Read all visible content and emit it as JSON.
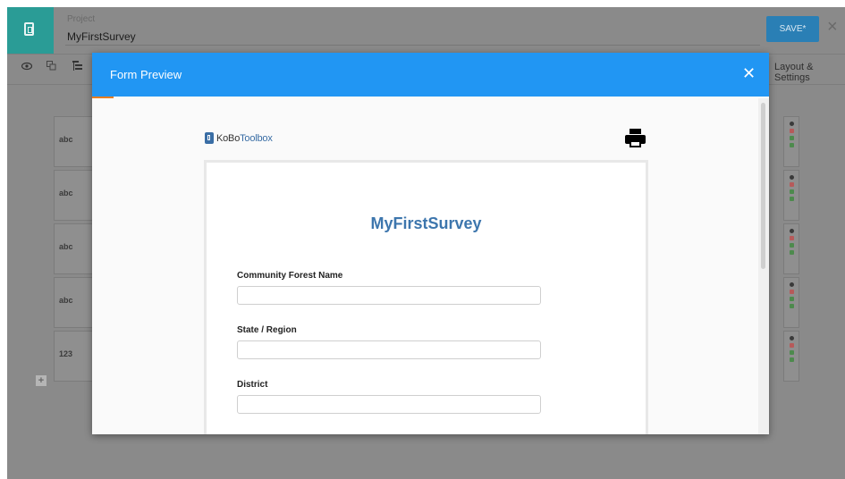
{
  "header": {
    "project_label": "Project",
    "project_name": "MyFirstSurvey",
    "save_label": "SAVE*",
    "close_glyph": "×"
  },
  "toolbar": {
    "preview_icon": "eye-icon",
    "layout_settings_label": "Layout & Settings"
  },
  "rows": [
    {
      "type": "abc"
    },
    {
      "type": "abc"
    },
    {
      "type": "abc"
    },
    {
      "type": "abc"
    },
    {
      "type": "123"
    }
  ],
  "modal": {
    "title": "Form Preview",
    "close_glyph": "✕",
    "logo_text_kobo": "KoBo",
    "logo_text_toolbox": "Toolbox",
    "form": {
      "title": "MyFirstSurvey",
      "questions": [
        {
          "label": "Community Forest Name",
          "value": ""
        },
        {
          "label": "State / Region",
          "value": ""
        },
        {
          "label": "District",
          "value": ""
        }
      ]
    }
  },
  "colors": {
    "accent": "#2196f3",
    "title": "#3d76ad",
    "save": "#2a7fb5",
    "logo_bg": "#2a9c96"
  }
}
